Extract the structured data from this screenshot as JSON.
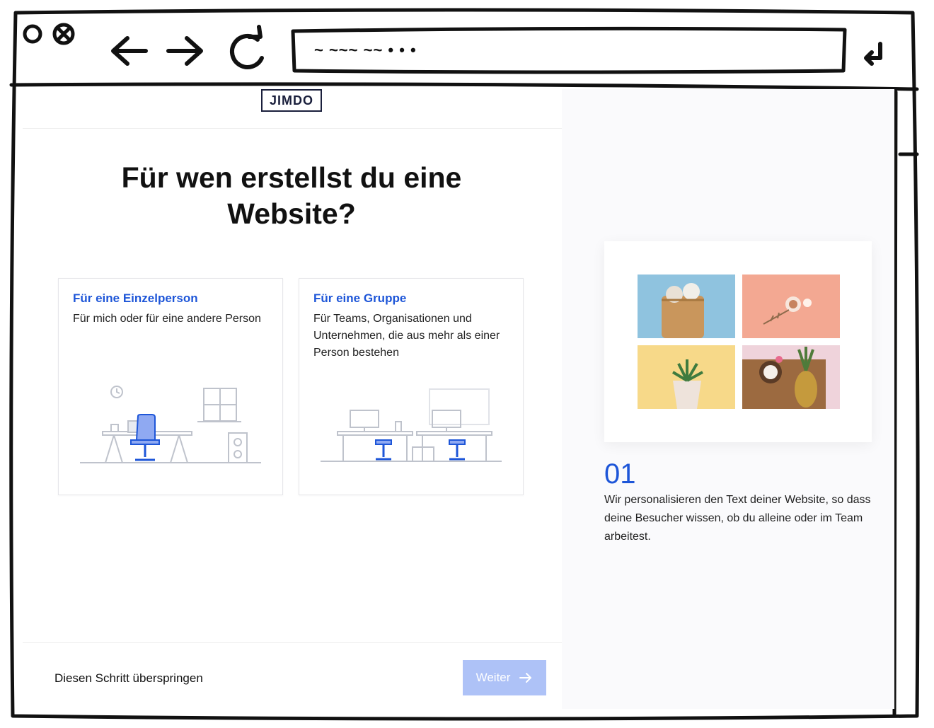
{
  "browser": {
    "url_placeholder": "~ ~~~ ~~ • • •",
    "back_icon": "arrow-left-icon",
    "forward_icon": "arrow-right-icon",
    "reload_icon": "reload-icon",
    "enter_icon": "enter-icon"
  },
  "header": {
    "logo_text": "JIMDO"
  },
  "main": {
    "heading": "Für wen erstellst du eine Website?",
    "cards": [
      {
        "title": "Für eine Einzelperson",
        "description": "Für mich oder für eine andere Person"
      },
      {
        "title": "Für eine Gruppe",
        "description": "Für Teams, Organisationen und Unternehmen, die aus mehr als einer Person bestehen"
      }
    ]
  },
  "footer": {
    "skip_label": "Diesen Schritt überspringen",
    "next_label": "Weiter"
  },
  "side": {
    "step_number": "01",
    "step_text": "Wir personalisieren den Text deiner Website, so dass deine Besucher wissen, ob du alleine oder im Team arbeitest."
  },
  "colors": {
    "accent": "#1e56d8",
    "button_disabled": "#aec2f7",
    "logo": "#1a1f3c"
  }
}
